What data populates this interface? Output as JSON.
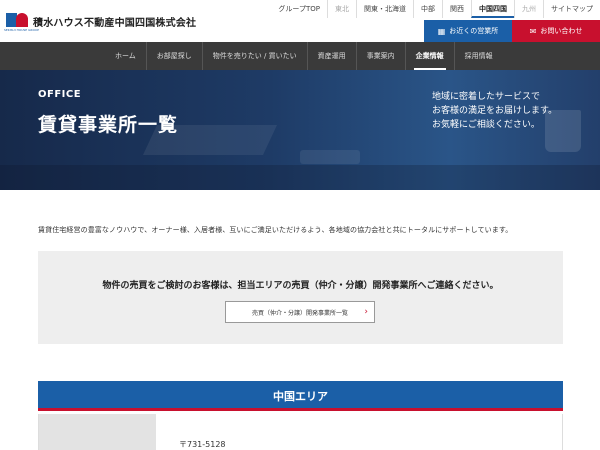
{
  "header": {
    "logo_sub": "SEKISUI HOUSE GROUP",
    "logo_text": "積水ハウス不動産中国四国株式会社",
    "top_links": [
      {
        "label": "グループTOP"
      },
      {
        "label": "東北"
      },
      {
        "label": "関東・北海道"
      },
      {
        "label": "中部"
      },
      {
        "label": "関西"
      },
      {
        "label": "中国四国"
      },
      {
        "label": "九州"
      },
      {
        "label": "サイトマップ"
      }
    ],
    "nearby_office_label": "お近くの営業所",
    "contact_label": "お問い合わせ"
  },
  "nav": {
    "items": [
      {
        "label": "ホーム"
      },
      {
        "label": "お部屋探し"
      },
      {
        "label": "物件を売りたい / 買いたい"
      },
      {
        "label": "資産運用"
      },
      {
        "label": "事業案内"
      },
      {
        "label": "企業情報"
      },
      {
        "label": "採用情報"
      }
    ],
    "active_index": 5
  },
  "hero": {
    "title_en": "OFFICE",
    "title_ja": "賃貸事業所一覧",
    "copy_line1": "地域に密着したサービスで",
    "copy_line2": "お客様の満足をお届けします。",
    "copy_line3": "お気軽にご相談ください。"
  },
  "intro": {
    "text": "賃貸住宅経営の豊富なノウハウで、オーナー様、入居者様、互いにご満足いただけるよう、各地域の協力会社と共にトータルにサポートしています。"
  },
  "sales_box": {
    "message": "物件の売買をご検討のお客様は、担当エリアの売買（仲介・分譲）開発事業所へご連絡ください。",
    "button_label": "売買（仲介・分譲）開発事業所一覧"
  },
  "area": {
    "title": "中国エリア",
    "office_zip": "〒731-5128"
  },
  "colors": {
    "brand_blue": "#1b5fa7",
    "brand_red": "#c8102e",
    "nav_bg": "#3a3a3a"
  }
}
